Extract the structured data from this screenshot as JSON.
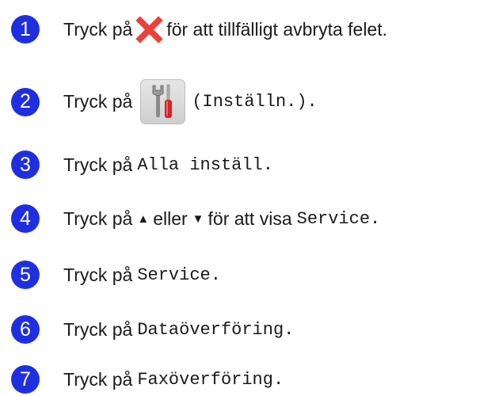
{
  "steps": [
    {
      "num": "1",
      "prefix": "Tryck på",
      "suffix": "för att tillfälligt avbryta felet.",
      "icon": "close-x-icon",
      "icon_color": "#e8423a"
    },
    {
      "num": "2",
      "prefix": "Tryck på",
      "mono": "(Inställn.).",
      "icon": "settings-tools-icon"
    },
    {
      "num": "3",
      "prefix": "Tryck på",
      "mono": "Alla inställ."
    },
    {
      "num": "4",
      "prefix": "Tryck på",
      "up": "▲",
      "middle": "eller",
      "down": "▼",
      "tail": "för att visa",
      "mono": "Service."
    },
    {
      "num": "5",
      "prefix": "Tryck på",
      "mono": "Service."
    },
    {
      "num": "6",
      "prefix": "Tryck på",
      "mono": "Dataöverföring."
    },
    {
      "num": "7",
      "prefix": "Tryck på",
      "mono": "Faxöverföring."
    }
  ],
  "colors": {
    "step_badge": "#1f2fe0",
    "cross": "#e8423a"
  }
}
